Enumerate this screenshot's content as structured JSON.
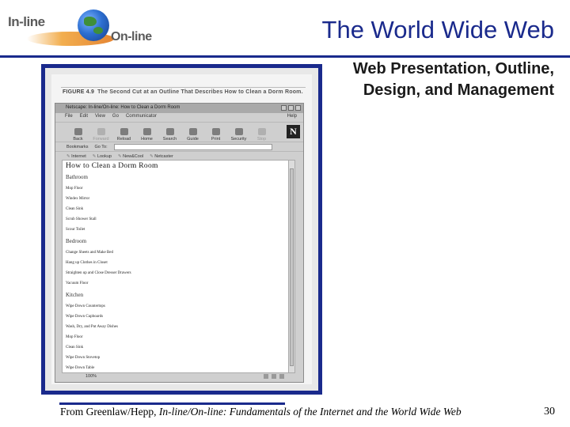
{
  "logo": {
    "text_inline": "In-line",
    "text_online": "On-line"
  },
  "slide": {
    "title": "The World Wide Web",
    "subtitle_line1": "Web Presentation, Outline,",
    "subtitle_line2": "Design, and Management",
    "footer_prefix": "From Greenlaw/Hepp, ",
    "footer_italic": "In-line/On-line: Fundamentals of the Internet and the World Wide Web",
    "page_number": "30"
  },
  "figure": {
    "label": "FIGURE 4.9",
    "caption": "The Second Cut at an Outline That Describes How to Clean a Dorm Room."
  },
  "browser": {
    "window_title": "Netscape: In-line/On-line: How to Clean a Dorm Room",
    "menu": [
      "File",
      "Edit",
      "View",
      "Go",
      "Communicator"
    ],
    "menu_help": "Help",
    "toolbar": [
      {
        "label": "Back",
        "icon": "back-arrow-icon",
        "enabled": true
      },
      {
        "label": "Forward",
        "icon": "forward-arrow-icon",
        "enabled": false
      },
      {
        "label": "Reload",
        "icon": "reload-icon",
        "enabled": true
      },
      {
        "label": "Home",
        "icon": "home-icon",
        "enabled": true
      },
      {
        "label": "Search",
        "icon": "search-icon",
        "enabled": true
      },
      {
        "label": "Guide",
        "icon": "guide-icon",
        "enabled": true
      },
      {
        "label": "Print",
        "icon": "print-icon",
        "enabled": true
      },
      {
        "label": "Security",
        "icon": "security-lock-icon",
        "enabled": true
      },
      {
        "label": "Stop",
        "icon": "stop-icon",
        "enabled": false
      }
    ],
    "netscape_logo": "N",
    "bookmarks_label": "Bookmarks",
    "goto_label": "Go To:",
    "personal_toolbar": [
      "Internet",
      "Lookup",
      "New&Cool",
      "Netcaster"
    ],
    "status_zoom": "100%"
  },
  "page": {
    "heading": "How to Clean a Dorm Room",
    "sections": [
      {
        "title": "Bathroom",
        "items": [
          "Mop Floor",
          "Windex Mirror",
          "Clean Sink",
          "Scrub Shower Stall",
          "Scour Toilet"
        ]
      },
      {
        "title": "Bedroom",
        "items": [
          "Change Sheets and Make Bed",
          "Hang up Clothes in Closet",
          "Straighten up and Close Dresser Drawers",
          "Vacuum Floor"
        ]
      },
      {
        "title": "Kitchen",
        "items": [
          "Wipe Down Countertops",
          "Wipe Down Cupboards",
          "Wash, Dry, and Put Away Dishes",
          "Mop Floor",
          "Clean Sink",
          "Wipe Down Stovetop",
          "Wipe Down Table"
        ]
      }
    ]
  },
  "colors": {
    "accent": "#1a2a8c",
    "section_text": "#333333"
  }
}
